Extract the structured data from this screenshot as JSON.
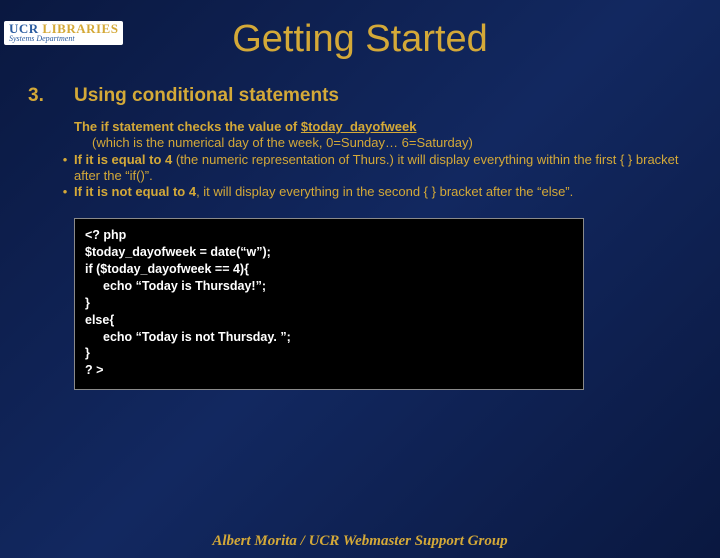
{
  "logo": {
    "ucr": "UCR",
    "lib": " LIBRARIES",
    "sub": "Systems Department"
  },
  "title": "Getting Started",
  "section": {
    "num": "3.",
    "heading": "Using conditional statements"
  },
  "bullets": {
    "b1a": "The if statement checks the value of ",
    "b1var": "$today_dayofweek",
    "b1b": "(which is the numerical day of the week, 0=Sunday… 6=Saturday)",
    "b2a": "If it is equal to 4",
    "b2b": " (the numeric representation of Thurs.) it will display everything within the first { } bracket  after the “if()”.",
    "b3a": "If it is not equal to 4",
    "b3b": ", it will display everything in the second { } bracket after the “else”."
  },
  "code": {
    "l1": "<? php",
    "l2": "$today_dayofweek = date(“w”);",
    "l3": "if ($today_dayofweek == 4){",
    "l4": "echo “Today is Thursday!”;",
    "l5": "}",
    "l6": "else{",
    "l7": "echo “Today is not Thursday. ”;",
    "l8": "}",
    "l9": "? >"
  },
  "footer": "Albert Morita / UCR Webmaster Support Group"
}
